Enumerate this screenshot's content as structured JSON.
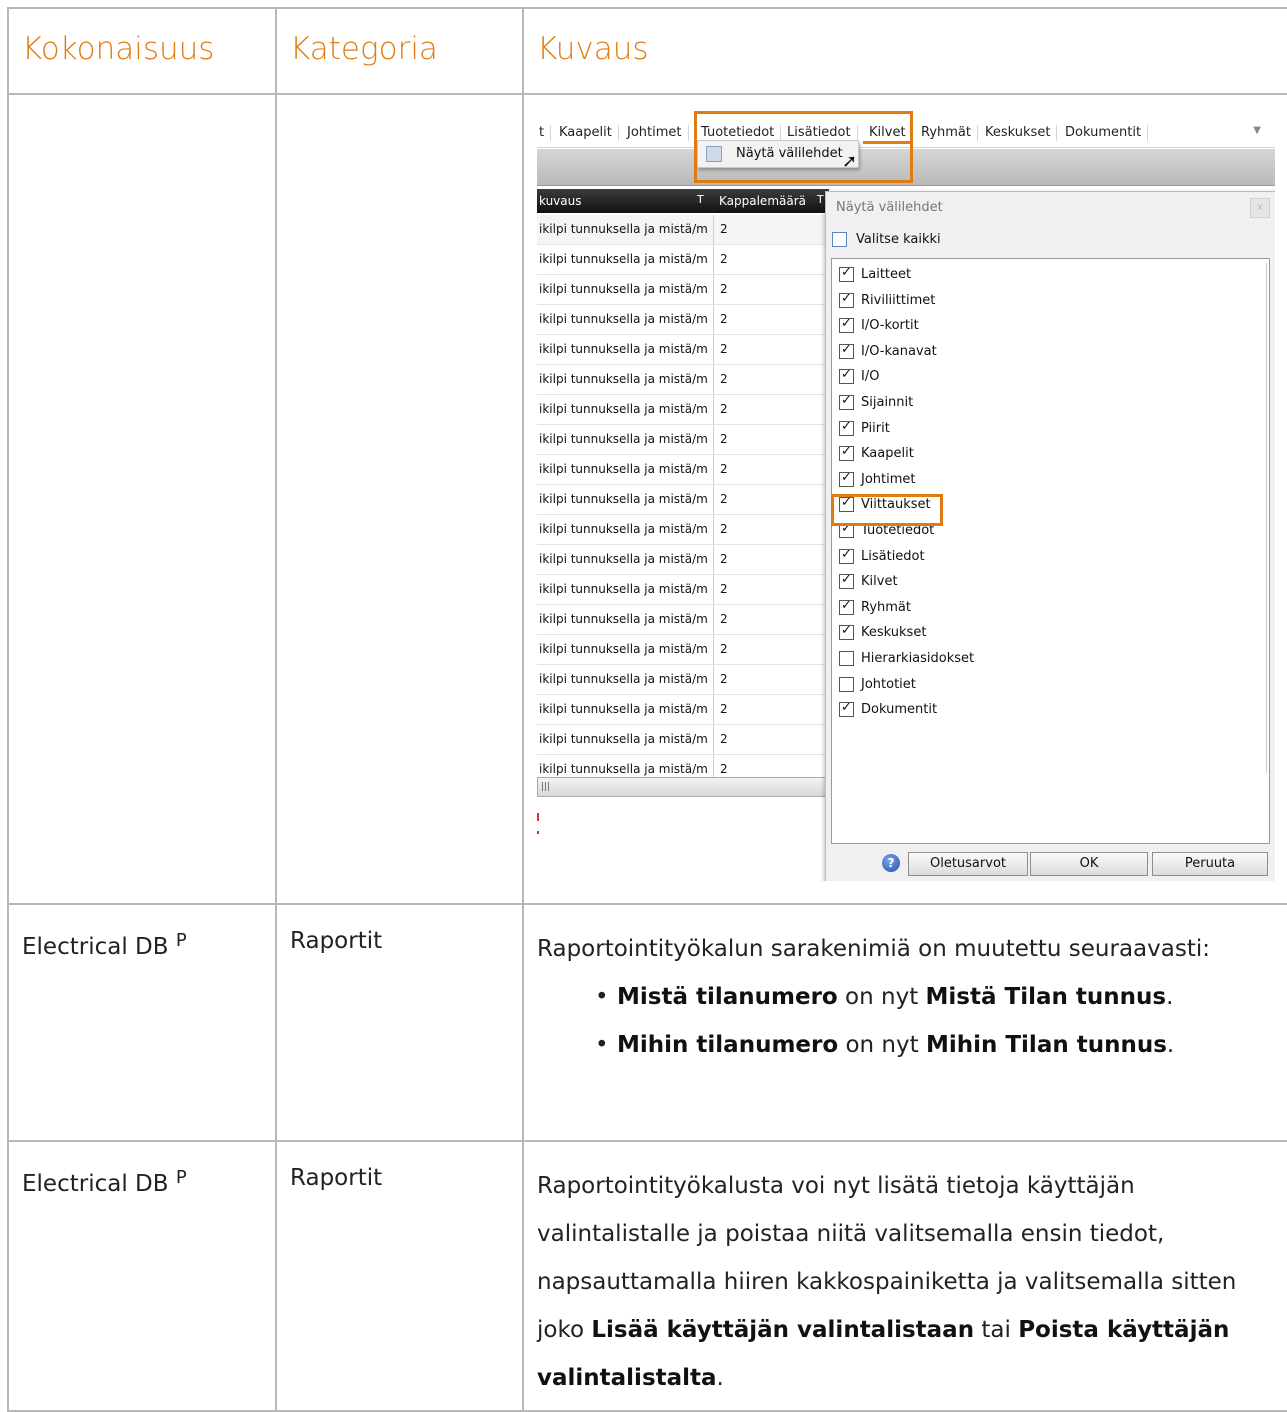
{
  "header": {
    "col1": "Kokonaisuus",
    "col2": "Kategoria",
    "col3": "Kuvaus"
  },
  "screenshot": {
    "tabs": [
      "t",
      "Kaapelit",
      "Johtimet",
      "Tuotetiedot",
      "Lisätiedot",
      "Kilvet",
      "Ryhmät",
      "Keskukset",
      "Dokumentit"
    ],
    "context_menu_item": "Näytä välilehdet",
    "grid": {
      "col1_header": "kuvaus",
      "col2_header": "Kappalemäärä",
      "row_text": "ikilpi tunnuksella ja mistä/m",
      "row_value": "2",
      "row_count": 19
    },
    "dialog": {
      "title": "Näytä välilehdet",
      "close": "x",
      "select_all": "Valitse kaikki",
      "items": [
        {
          "label": "Laitteet",
          "checked": true
        },
        {
          "label": "Riviliittimet",
          "checked": true
        },
        {
          "label": "I/O-kortit",
          "checked": true
        },
        {
          "label": "I/O-kanavat",
          "checked": true
        },
        {
          "label": "I/O",
          "checked": true
        },
        {
          "label": "Sijainnit",
          "checked": true
        },
        {
          "label": "Piirit",
          "checked": true
        },
        {
          "label": "Kaapelit",
          "checked": true
        },
        {
          "label": "Johtimet",
          "checked": true
        },
        {
          "label": "Viittaukset",
          "checked": true
        },
        {
          "label": "Tuotetiedot",
          "checked": true
        },
        {
          "label": "Lisätiedot",
          "checked": true
        },
        {
          "label": "Kilvet",
          "checked": true
        },
        {
          "label": "Ryhmät",
          "checked": true
        },
        {
          "label": "Keskukset",
          "checked": true
        },
        {
          "label": "Hierarkiasidokset",
          "checked": false
        },
        {
          "label": "Johtotiet",
          "checked": false
        },
        {
          "label": "Dokumentit",
          "checked": true
        }
      ],
      "buttons": {
        "defaults": "Oletusarvot",
        "ok": "OK",
        "cancel": "Peruuta"
      }
    }
  },
  "rows": [
    {
      "entity": "Electrical DB",
      "sup": "P",
      "category": "Raportit",
      "intro": "Raportointityökalun sarakenimiä on muutettu seuraavasti:",
      "bullets": [
        {
          "old": "Mistä tilanumero",
          "mid": " on nyt ",
          "new": "Mistä Tilan tunnus",
          "end": "."
        },
        {
          "old": "Mihin tilanumero",
          "mid": " on nyt ",
          "new": "Mihin Tilan tunnus",
          "end": "."
        }
      ]
    },
    {
      "entity": "Electrical DB",
      "sup": "P",
      "category": "Raportit",
      "text1": "Raportointityökalusta voi nyt lisätä tietoja käyttäjän valintalistalle ja poistaa niitä valitsemalla ensin tiedot, napsauttamalla hiiren kakkospainiketta ja valitsemalla sitten joko ",
      "bold1": "Lisää käyttäjän valintalistaan",
      "mid": " tai ",
      "bold2": "Poista käyttäjän valintalistalta",
      "end": "."
    }
  ]
}
